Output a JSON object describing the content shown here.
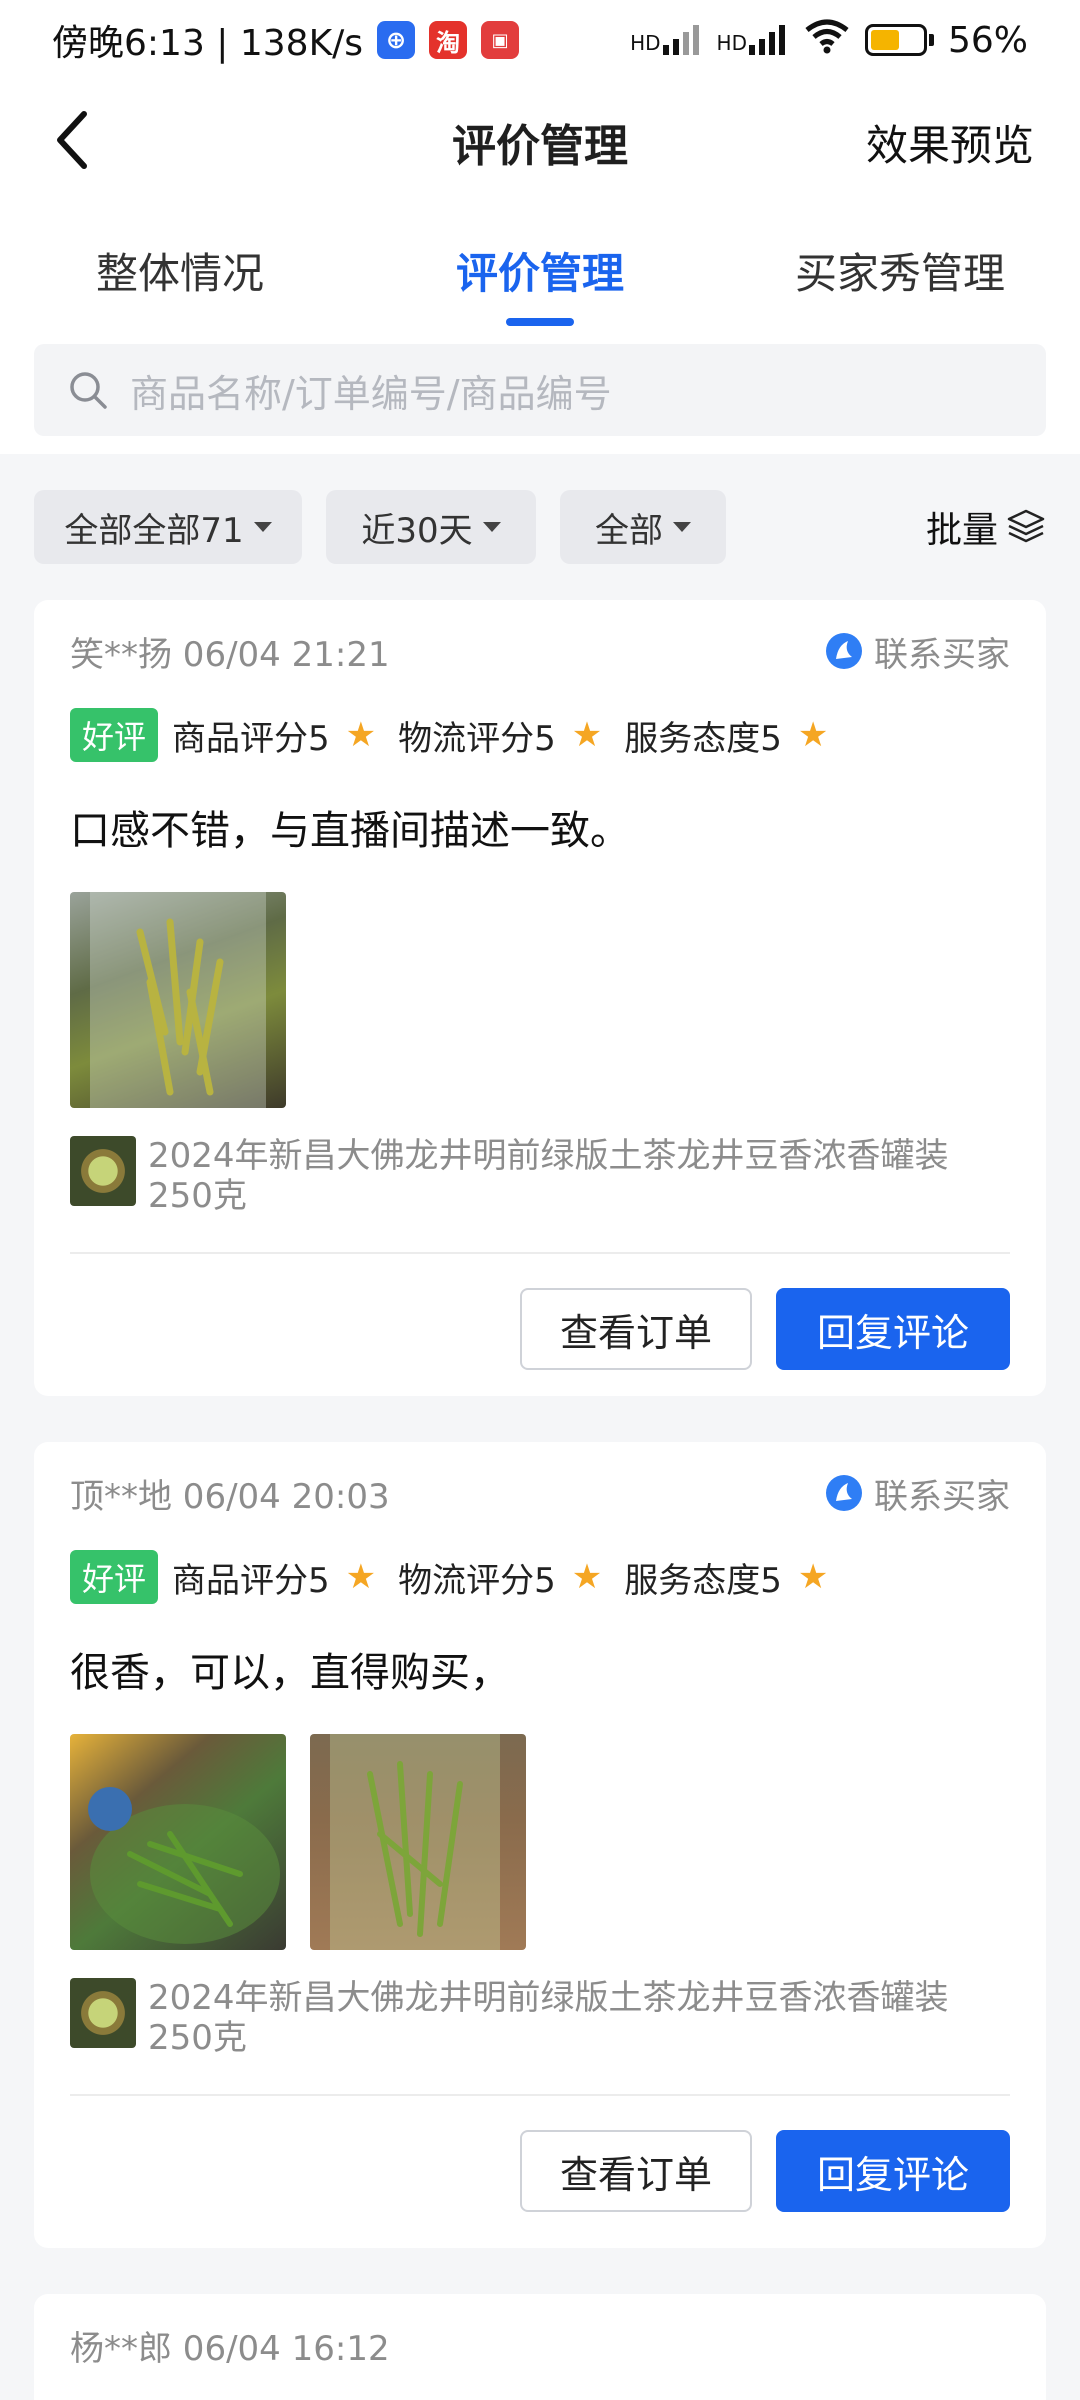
{
  "status_bar": {
    "time": "傍晚6:13 | 138K/s",
    "badge_tao": "淘",
    "battery": "56%",
    "battery_level": 0.56,
    "signal_label_1": "HD",
    "signal_label_2": "HD"
  },
  "header": {
    "title": "评价管理",
    "preview": "效果预览"
  },
  "tabs": [
    {
      "label": "整体情况",
      "active": false
    },
    {
      "label": "评价管理",
      "active": true
    },
    {
      "label": "买家秀管理",
      "active": false
    }
  ],
  "search": {
    "placeholder": "商品名称/订单编号/商品编号"
  },
  "filters": {
    "all_reviews": "全部全部71",
    "time_range": "近30天",
    "type": "全部",
    "batch": "批量"
  },
  "reviews": [
    {
      "buyer": "笑**扬 06/04 21:21",
      "contact": "联系买家",
      "tag": "好评",
      "product_rating": "商品评分5",
      "logistics_rating": "物流评分5",
      "service_rating": "服务态度5",
      "comment": "口感不错，与直播间描述一致。",
      "product_name": "2024年新昌大佛龙井明前绿版土茶龙井豆香浓香罐装250克",
      "view_order": "查看订单",
      "reply": "回复评论"
    },
    {
      "buyer": "顶**地 06/04 20:03",
      "contact": "联系买家",
      "tag": "好评",
      "product_rating": "商品评分5",
      "logistics_rating": "物流评分5",
      "service_rating": "服务态度5",
      "comment": "很香，可以，直得购买，",
      "product_name": "2024年新昌大佛龙井明前绿版土茶龙井豆香浓香罐装250克",
      "view_order": "查看订单",
      "reply": "回复评论"
    },
    {
      "buyer": "杨**郎 06/04 16:12"
    }
  ],
  "colors": {
    "accent": "#1a64ee",
    "good_tag": "#36c26a",
    "star": "#f5a623"
  }
}
